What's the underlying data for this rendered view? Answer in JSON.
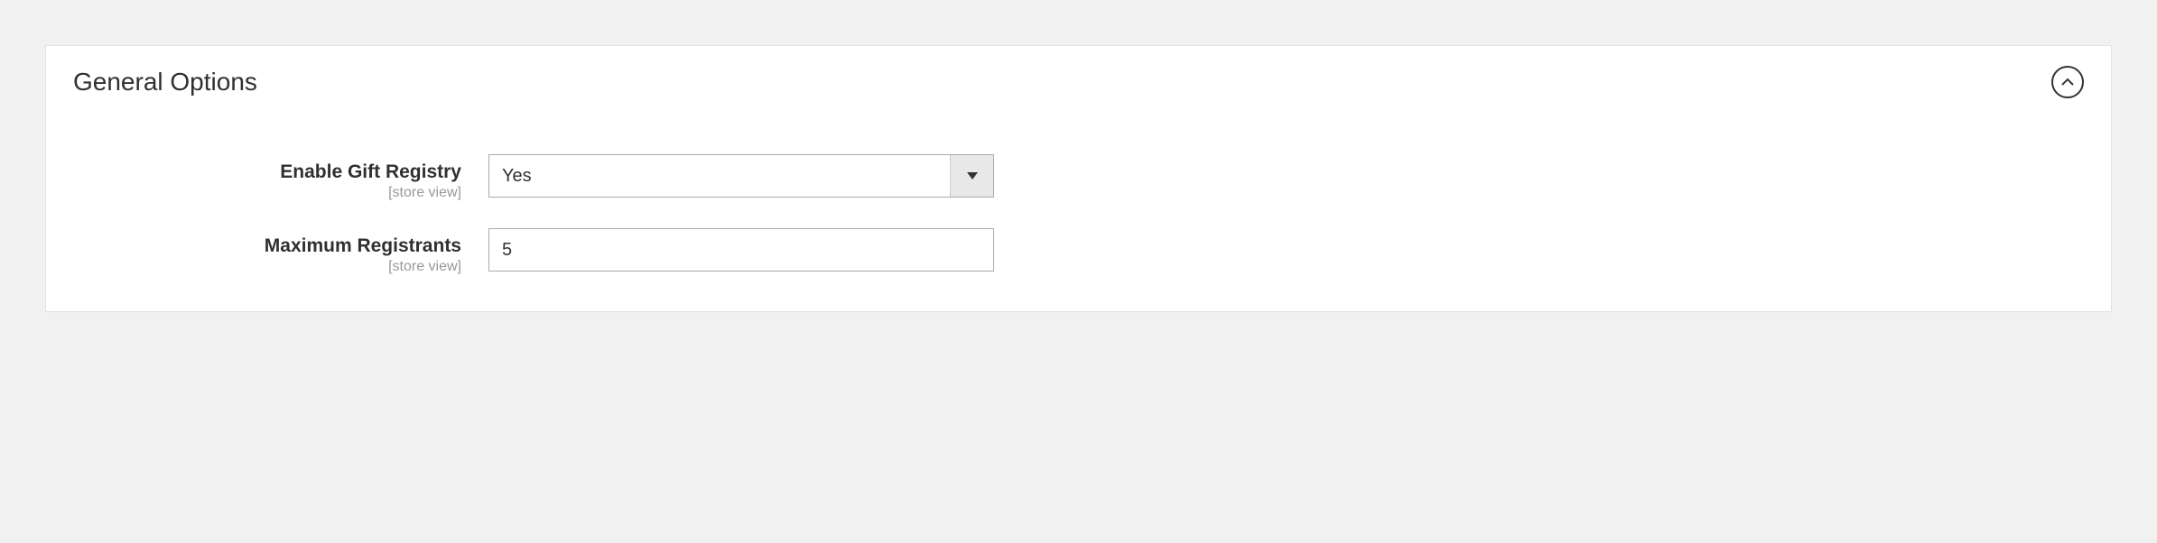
{
  "panel": {
    "title": "General Options"
  },
  "fields": {
    "enable_gift_registry": {
      "label": "Enable Gift Registry",
      "scope": "[store view]",
      "value": "Yes"
    },
    "maximum_registrants": {
      "label": "Maximum Registrants",
      "scope": "[store view]",
      "value": "5"
    }
  }
}
